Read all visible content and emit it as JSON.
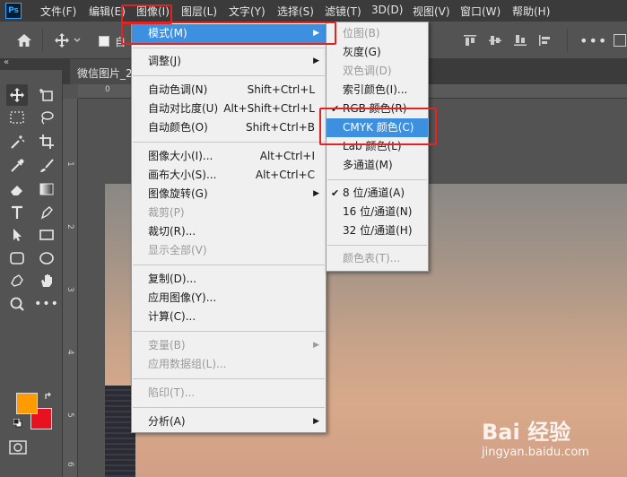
{
  "menubar": {
    "logo": "Ps",
    "items": [
      "文件(F)",
      "编辑(E)",
      "图像(I)",
      "图层(L)",
      "文字(Y)",
      "选择(S)",
      "滤镜(T)",
      "3D(D)",
      "视图(V)",
      "窗口(W)",
      "帮助(H)"
    ]
  },
  "options": {
    "auto_select_label": "自"
  },
  "document": {
    "tab_title": "微信图片_2"
  },
  "ruler": {
    "h0": "0",
    "v_labels": [
      "1",
      "2",
      "3",
      "4",
      "5",
      "6"
    ]
  },
  "image_menu": {
    "items": [
      {
        "label": "模式(M)",
        "shortcut": "",
        "submenu": true,
        "disabled": false,
        "highlighted": true
      },
      {
        "label": "调整(J)",
        "shortcut": "",
        "submenu": true,
        "disabled": false
      },
      {
        "label": "自动色调(N)",
        "shortcut": "Shift+Ctrl+L",
        "disabled": false
      },
      {
        "label": "自动对比度(U)",
        "shortcut": "Alt+Shift+Ctrl+L",
        "disabled": false
      },
      {
        "label": "自动颜色(O)",
        "shortcut": "Shift+Ctrl+B",
        "disabled": false
      },
      {
        "label": "图像大小(I)...",
        "shortcut": "Alt+Ctrl+I",
        "disabled": false
      },
      {
        "label": "画布大小(S)...",
        "shortcut": "Alt+Ctrl+C",
        "disabled": false
      },
      {
        "label": "图像旋转(G)",
        "shortcut": "",
        "submenu": true,
        "disabled": false
      },
      {
        "label": "裁剪(P)",
        "shortcut": "",
        "disabled": true
      },
      {
        "label": "裁切(R)...",
        "shortcut": "",
        "disabled": false
      },
      {
        "label": "显示全部(V)",
        "shortcut": "",
        "disabled": true
      },
      {
        "label": "复制(D)...",
        "shortcut": "",
        "disabled": false
      },
      {
        "label": "应用图像(Y)...",
        "shortcut": "",
        "disabled": false
      },
      {
        "label": "计算(C)...",
        "shortcut": "",
        "disabled": false
      },
      {
        "label": "变量(B)",
        "shortcut": "",
        "submenu": true,
        "disabled": true
      },
      {
        "label": "应用数据组(L)...",
        "shortcut": "",
        "disabled": true
      },
      {
        "label": "陷印(T)...",
        "shortcut": "",
        "disabled": true
      },
      {
        "label": "分析(A)",
        "shortcut": "",
        "submenu": true,
        "disabled": false
      }
    ]
  },
  "mode_menu": {
    "items": [
      {
        "label": "位图(B)",
        "disabled": true
      },
      {
        "label": "灰度(G)",
        "disabled": false
      },
      {
        "label": "双色调(D)",
        "disabled": true
      },
      {
        "label": "索引颜色(I)...",
        "disabled": false
      },
      {
        "label": "RGB 颜色(R)",
        "disabled": false,
        "checked": true
      },
      {
        "label": "CMYK 颜色(C)",
        "disabled": false,
        "highlighted": true
      },
      {
        "label": "Lab 颜色(L)",
        "disabled": false
      },
      {
        "label": "多通道(M)",
        "disabled": false
      },
      {
        "label": "8 位/通道(A)",
        "disabled": false,
        "checked": true
      },
      {
        "label": "16 位/通道(N)",
        "disabled": false
      },
      {
        "label": "32 位/通道(H)",
        "disabled": false
      },
      {
        "label": "颜色表(T)...",
        "disabled": true
      }
    ]
  },
  "colors": {
    "foreground": "#ff9a00",
    "background": "#e8111f",
    "highlight": "#3d8fe0",
    "annotation": "#e52222"
  },
  "watermark": {
    "logo": "Bai 经验",
    "sub": "jingyan.baidu.com"
  }
}
